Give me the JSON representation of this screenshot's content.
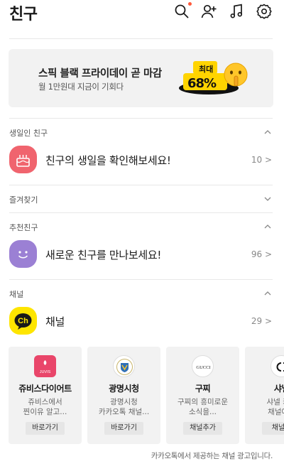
{
  "header": {
    "title": "친구",
    "icons": [
      "search-icon",
      "add-friend-icon",
      "music-icon",
      "settings-icon"
    ],
    "notification_color": "#ff5a3c"
  },
  "banner": {
    "title": "스픽 블랙 프라이데이 곧 마감",
    "subtitle": "월 1만원대 지금이 기회다",
    "badge_top": "최대",
    "badge_percent": "68%",
    "badge_color": "#ffd400"
  },
  "birthday": {
    "section_label": "생일인 친구",
    "row_text": "친구의 생일을 확인해보세요!",
    "count": "10 >",
    "icon_color": "#f0646e"
  },
  "favorites": {
    "section_label": "즐겨찾기"
  },
  "recommended": {
    "section_label": "추천친구",
    "row_text": "새로운 친구를 만나보세요!",
    "count": "96 >",
    "icon_color": "#9b80d4"
  },
  "channels": {
    "section_label": "채널",
    "row_text": "채널",
    "count": "29 >",
    "icon_label": "Ch",
    "icon_color": "#fee500",
    "cards": [
      {
        "name": "쥬비스다이어트",
        "desc": "쥬비스에서\n찐이유 알고...",
        "button": "바로가기",
        "logo_text": "JUVIS"
      },
      {
        "name": "광명시청",
        "desc": "광명시청\n카카오톡 채널...",
        "button": "바로가기",
        "logo_text": ""
      },
      {
        "name": "구찌",
        "desc": "구찌의 흥미로운\n소식을...",
        "button": "채널추가",
        "logo_text": "GUCCI"
      },
      {
        "name": "샤넬",
        "desc": "샤넬 카카\n채널에서",
        "button": "채널추",
        "logo_text": ""
      }
    ],
    "ad_note": "카카오톡에서 제공하는 채널 광고입니다."
  }
}
